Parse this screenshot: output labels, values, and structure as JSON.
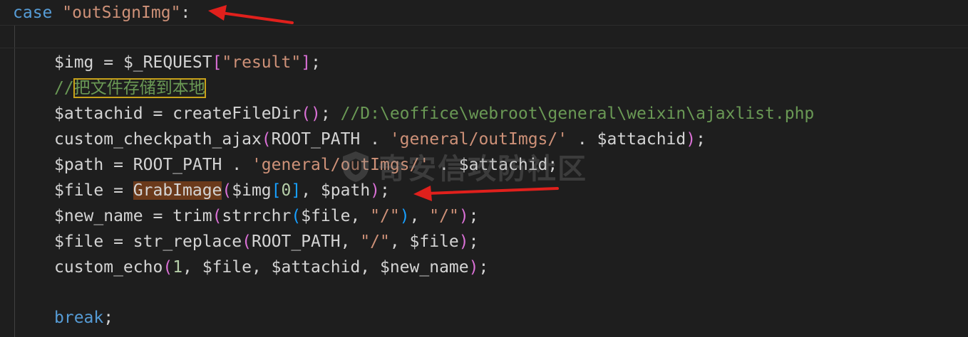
{
  "code": {
    "case_line": {
      "keyword": "case",
      "label": "\"outSignImg\"",
      "colon": ":"
    },
    "line_img": {
      "var": "$img",
      "op": " = ",
      "src": "$_REQUEST",
      "open": "[",
      "key": "\"result\"",
      "close": "]",
      "end": ";"
    },
    "line_comment": {
      "slashes": "//",
      "text": "把文件存储到本地"
    },
    "line_attachid": {
      "var": "$attachid",
      "op": " = ",
      "fn": "createFileDir",
      "parens": "()",
      "end": ";",
      "comment": " //D:\\eoffice\\webroot\\general\\weixin\\ajaxlist.php"
    },
    "line_checkpath": {
      "fn": "custom_checkpath_ajax",
      "open": "(",
      "args_a": "ROOT_PATH . ",
      "str": "'general/outImgs/'",
      "args_b": " . $attachid",
      "close": ")",
      "end": ";"
    },
    "line_path": {
      "text_a": "$path = ROOT_PATH . ",
      "str": "'general/outImgs/'",
      "text_b": " . $attachid;"
    },
    "line_file": {
      "var": "$file = ",
      "fn": "GrabImage",
      "open": "(",
      "arg_a": "$img",
      "idx_open": "[",
      "idx": "0",
      "idx_close": "]",
      "arg_b": ", $path",
      "close": ")",
      "end": ";"
    },
    "line_newname": {
      "var": "$new_name = ",
      "fn": "trim",
      "open": "(",
      "fn2": "strrchr",
      "open2": "(",
      "arg": "$file, ",
      "str1": "\"/\"",
      "close2": ")",
      "sep": ", ",
      "str2": "\"/\"",
      "close": ")",
      "end": ";"
    },
    "line_replace": {
      "var": "$file = ",
      "fn": "str_replace",
      "open": "(",
      "arg_a": "ROOT_PATH, ",
      "str": "\"/\"",
      "arg_b": ", $file",
      "close": ")",
      "end": ";"
    },
    "line_echo": {
      "fn": "custom_echo",
      "open": "(",
      "num": "1",
      "args": ", $file, $attachid, $new_name",
      "close": ")",
      "end": ";"
    },
    "line_break": {
      "keyword": "break",
      "end": ";"
    }
  },
  "watermark": {
    "text": "奇安信攻防社区"
  },
  "annotations": {
    "arrow_color": "#e0201c"
  }
}
